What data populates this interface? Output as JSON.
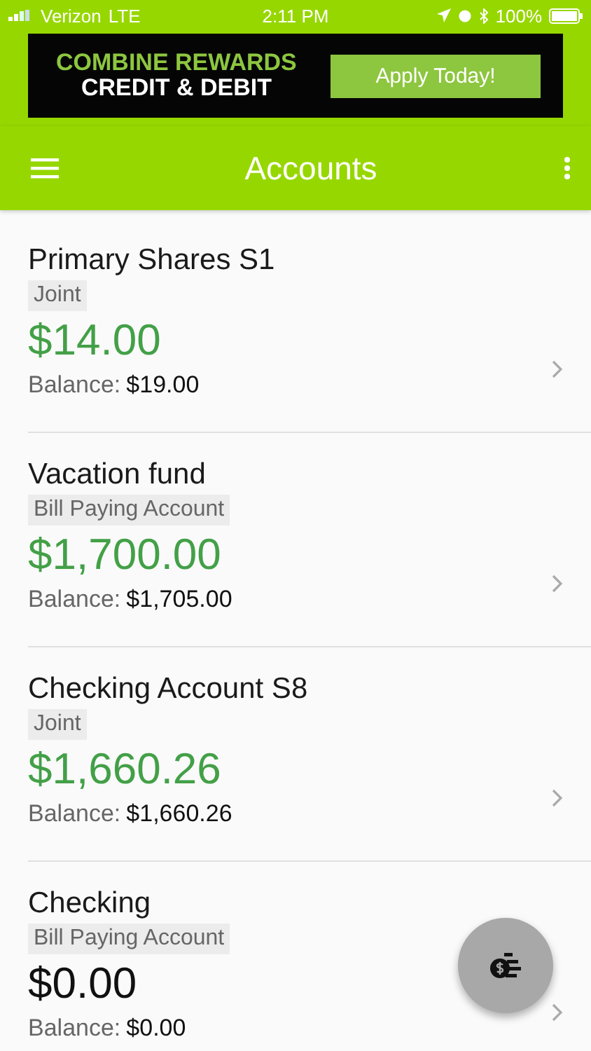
{
  "status_bar": {
    "carrier": "Verizon",
    "network": "LTE",
    "time": "2:11 PM",
    "battery": "100%"
  },
  "ad": {
    "headline": "COMBINE REWARDS",
    "subline": "CREDIT & DEBIT",
    "button": "Apply Today!"
  },
  "header": {
    "title": "Accounts"
  },
  "accounts": [
    {
      "name": "Primary Shares S1",
      "tag": "Joint",
      "amount": "$14.00",
      "color": "#43a047",
      "balance_label": "Balance:",
      "balance": "$19.00"
    },
    {
      "name": "Vacation fund",
      "tag": "Bill Paying Account",
      "amount": "$1,700.00",
      "color": "#43a047",
      "balance_label": "Balance:",
      "balance": "$1,705.00"
    },
    {
      "name": "Checking Account S8",
      "tag": "Joint",
      "amount": "$1,660.26",
      "color": "#43a047",
      "balance_label": "Balance:",
      "balance": "$1,660.26"
    },
    {
      "name": "Checking",
      "tag": "Bill Paying Account",
      "amount": "$0.00",
      "color": "#111111",
      "balance_label": "Balance:",
      "balance": "$0.00"
    }
  ]
}
